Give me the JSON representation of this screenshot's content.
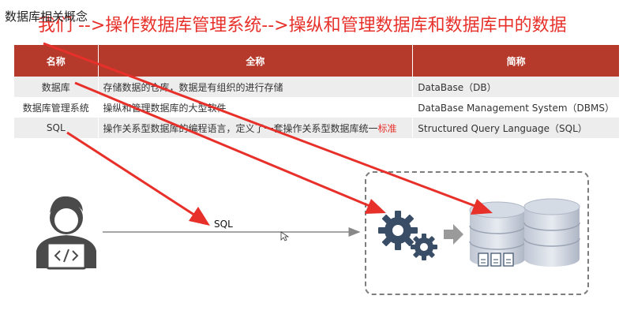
{
  "section_title": "数据库相关概念",
  "headline": "我们 -->操作数据库管理系统-->操纵和管理数据库和数据库中的数据",
  "table": {
    "headers": [
      "名称",
      "全称",
      "简称"
    ],
    "rows": [
      {
        "name": "数据库",
        "full": "存储数据的仓库，数据是有组织的进行存储",
        "full_hl": "",
        "short": "DataBase（DB）"
      },
      {
        "name": "数据库管理系统",
        "full": "操纵和管理数据库的大型软件",
        "full_hl": "",
        "short": "DataBase Management System（DBMS）"
      },
      {
        "name": "SQL",
        "full": "操作关系型数据库的编程语言，定义了一套操作关系型数据库统一",
        "full_hl": "标准",
        "short": "Structured Query Language（SQL）"
      }
    ]
  },
  "diagram": {
    "sql_label": "SQL",
    "user_icon": "developer-icon",
    "gears_icon": "gears-icon",
    "db_icon": "database-icon",
    "arrow_color": "#e8302a",
    "accent_color": "#b53a2b"
  }
}
